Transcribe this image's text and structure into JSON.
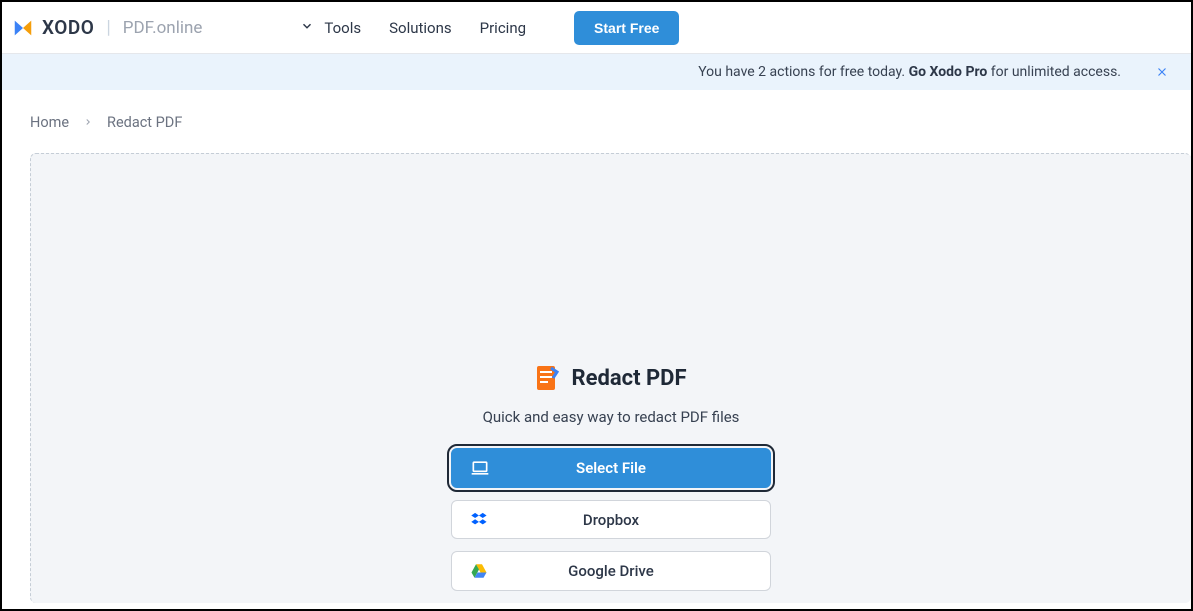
{
  "header": {
    "logo_text": "XODO",
    "sublogo": "PDF.online",
    "nav": {
      "tools": "Tools",
      "solutions": "Solutions",
      "pricing": "Pricing"
    },
    "cta": "Start Free"
  },
  "banner": {
    "text_before": "You have 2 actions for free today. ",
    "bold": "Go Xodo Pro",
    "text_after": " for unlimited access."
  },
  "breadcrumb": {
    "home": "Home",
    "current": "Redact PDF"
  },
  "dropzone": {
    "title": "Redact PDF",
    "subtitle": "Quick and easy way to redact PDF files",
    "buttons": {
      "select_file": "Select File",
      "dropbox": "Dropbox",
      "google_drive": "Google Drive"
    }
  }
}
